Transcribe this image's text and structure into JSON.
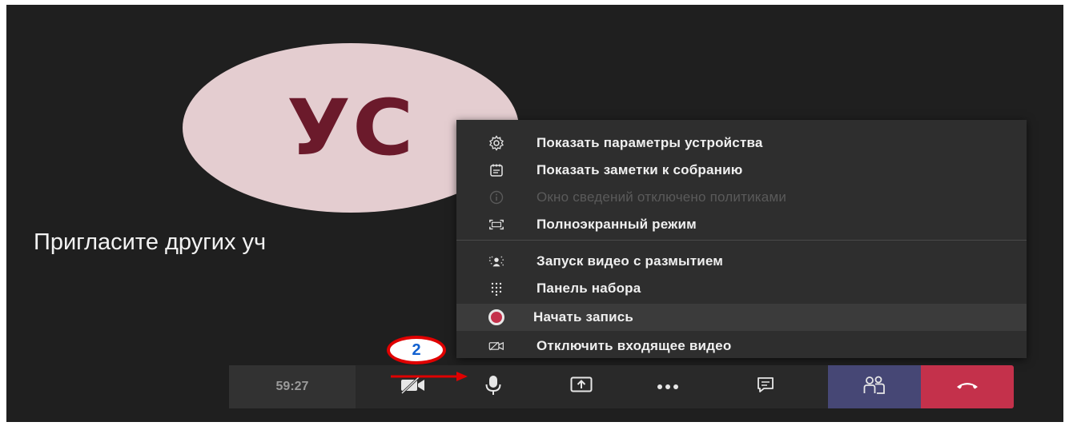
{
  "participant": {
    "initials": "УС",
    "avatar_color": "#e4cdd0",
    "initials_color": "#6b1a2b"
  },
  "stage": {
    "invite_text": "Пригласите других уч"
  },
  "menu": {
    "items": [
      {
        "label": "Показать параметры устройства",
        "icon": "gear-icon",
        "enabled": true
      },
      {
        "label": "Показать заметки к собранию",
        "icon": "notes-icon",
        "enabled": true
      },
      {
        "label": "Окно сведений отключено политиками",
        "icon": "info-icon",
        "enabled": false
      },
      {
        "label": "Полноэкранный режим",
        "icon": "fullscreen-icon",
        "enabled": true
      },
      {
        "label": "Запуск видео с размытием",
        "icon": "blur-background-icon",
        "enabled": true
      },
      {
        "label": "Панель набора",
        "icon": "dialpad-icon",
        "enabled": true
      },
      {
        "label": "Начать запись",
        "icon": "record-icon",
        "enabled": true,
        "highlighted": true
      },
      {
        "label": "Отключить входящее видео",
        "icon": "video-off-icon",
        "enabled": true
      }
    ]
  },
  "toolbar": {
    "timer": "59:27",
    "buttons": [
      {
        "name": "camera-toggle",
        "icon": "video-off-icon"
      },
      {
        "name": "mic-toggle",
        "icon": "microphone-icon"
      },
      {
        "name": "share-screen",
        "icon": "share-screen-icon"
      },
      {
        "name": "more-actions",
        "icon": "more-dots-icon"
      },
      {
        "name": "chat",
        "icon": "chat-icon"
      },
      {
        "name": "participants",
        "icon": "people-icon"
      },
      {
        "name": "hang-up",
        "icon": "phone-hangup-icon"
      }
    ]
  },
  "annotation": {
    "step_number": "2",
    "circle_color": "#e00000",
    "arrow_color": "#e00000"
  },
  "colors": {
    "stage_background": "#1f1f1f",
    "menu_background": "#2e2e2e",
    "record_dot": "#c4314b",
    "people_button": "#464775",
    "hangup_button": "#c4314b"
  }
}
